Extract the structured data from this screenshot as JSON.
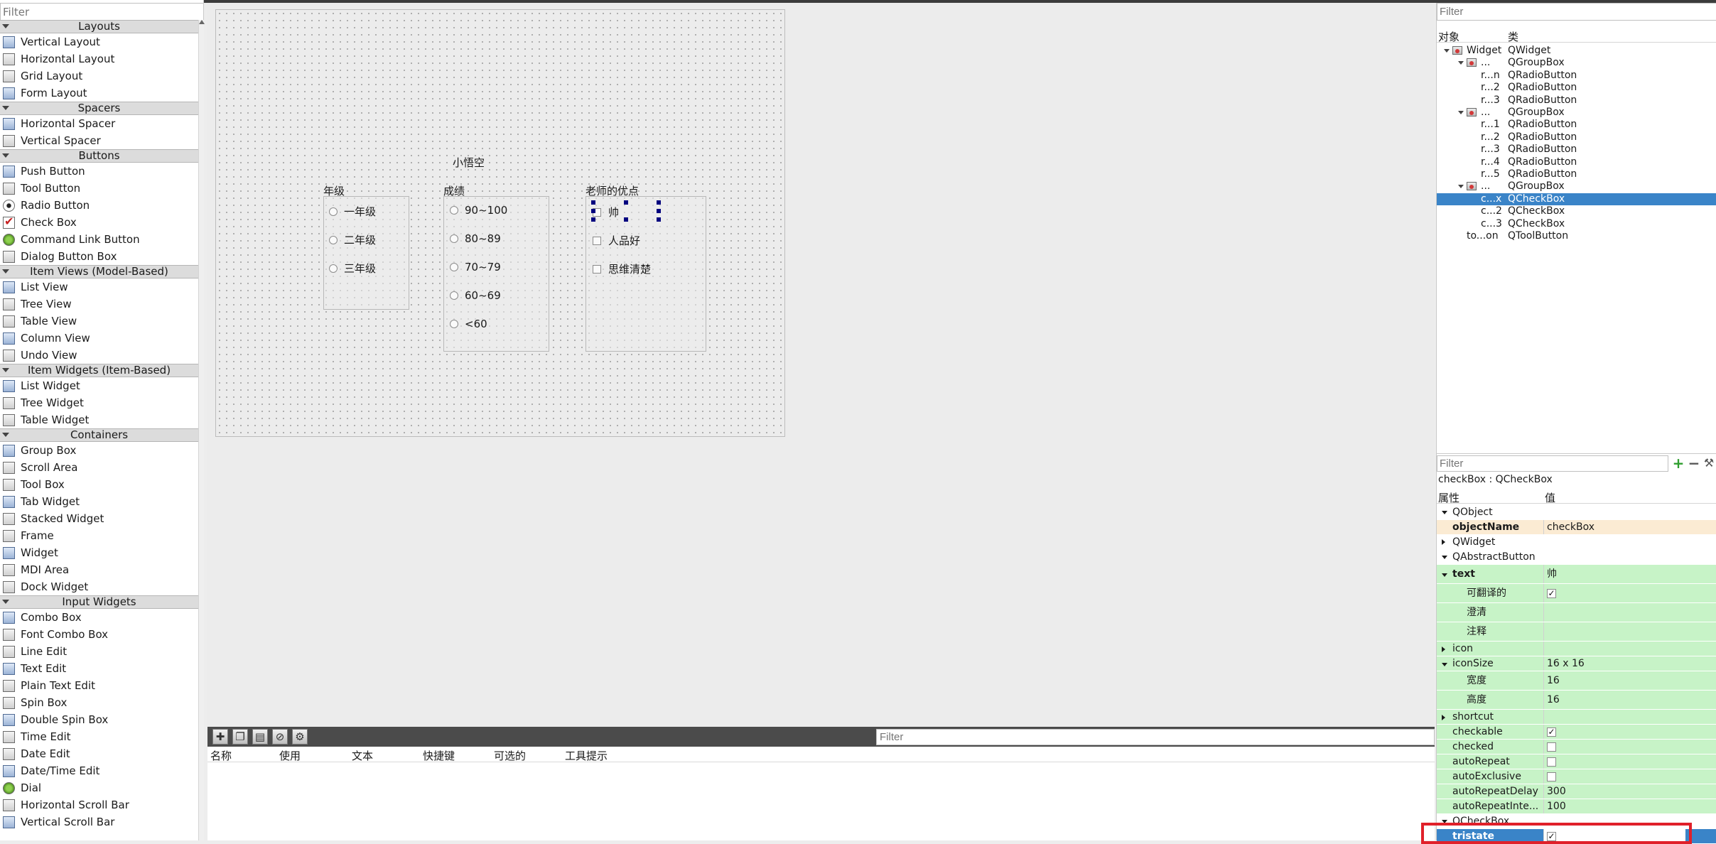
{
  "widget_box": {
    "filter_placeholder": "Filter",
    "categories": [
      {
        "title": "Layouts",
        "items": [
          "Vertical Layout",
          "Horizontal Layout",
          "Grid Layout",
          "Form Layout"
        ]
      },
      {
        "title": "Spacers",
        "items": [
          "Horizontal Spacer",
          "Vertical Spacer"
        ]
      },
      {
        "title": "Buttons",
        "items": [
          "Push Button",
          "Tool Button",
          "Radio Button",
          "Check Box",
          "Command Link Button",
          "Dialog Button Box"
        ]
      },
      {
        "title": "Item Views (Model-Based)",
        "items": [
          "List View",
          "Tree View",
          "Table View",
          "Column View",
          "Undo View"
        ]
      },
      {
        "title": "Item Widgets (Item-Based)",
        "items": [
          "List Widget",
          "Tree Widget",
          "Table Widget"
        ]
      },
      {
        "title": "Containers",
        "items": [
          "Group Box",
          "Scroll Area",
          "Tool Box",
          "Tab Widget",
          "Stacked Widget",
          "Frame",
          "Widget",
          "MDI Area",
          "Dock Widget"
        ]
      },
      {
        "title": "Input Widgets",
        "items": [
          "Combo Box",
          "Font Combo Box",
          "Line Edit",
          "Text Edit",
          "Plain Text Edit",
          "Spin Box",
          "Double Spin Box",
          "Time Edit",
          "Date Edit",
          "Date/Time Edit",
          "Dial",
          "Horizontal Scroll Bar",
          "Vertical Scroll Bar"
        ]
      }
    ]
  },
  "form": {
    "title_label": "小悟空",
    "group_grade": {
      "title": "年级",
      "options": [
        "一年级",
        "二年级",
        "三年级"
      ]
    },
    "group_score": {
      "title": "成绩",
      "options": [
        "90~100",
        "80~89",
        "70~79",
        "60~69",
        "<60"
      ]
    },
    "group_teacher": {
      "title": "老师的优点",
      "options": [
        "帅",
        "人品好",
        "思维清楚"
      ]
    }
  },
  "action_editor": {
    "filter_placeholder": "Filter",
    "columns": [
      "名称",
      "使用",
      "文本",
      "快捷键",
      "可选的",
      "工具提示"
    ]
  },
  "object_inspector": {
    "filter_placeholder": "Filter",
    "columns": [
      "对象",
      "类"
    ],
    "rows": [
      {
        "obj": "Widget",
        "cls": "QWidget",
        "depth": 0,
        "expanded": true,
        "icon": true
      },
      {
        "obj": "...",
        "cls": "QGroupBox",
        "depth": 1,
        "expanded": true,
        "icon": true
      },
      {
        "obj": "r...n",
        "cls": "QRadioButton",
        "depth": 2
      },
      {
        "obj": "r...2",
        "cls": "QRadioButton",
        "depth": 2
      },
      {
        "obj": "r...3",
        "cls": "QRadioButton",
        "depth": 2
      },
      {
        "obj": "...",
        "cls": "QGroupBox",
        "depth": 1,
        "expanded": true,
        "icon": true
      },
      {
        "obj": "r...1",
        "cls": "QRadioButton",
        "depth": 2
      },
      {
        "obj": "r...2",
        "cls": "QRadioButton",
        "depth": 2
      },
      {
        "obj": "r...3",
        "cls": "QRadioButton",
        "depth": 2
      },
      {
        "obj": "r...4",
        "cls": "QRadioButton",
        "depth": 2
      },
      {
        "obj": "r...5",
        "cls": "QRadioButton",
        "depth": 2
      },
      {
        "obj": "...",
        "cls": "QGroupBox",
        "depth": 1,
        "expanded": true,
        "icon": true
      },
      {
        "obj": "c...x",
        "cls": "QCheckBox",
        "depth": 2,
        "selected": true
      },
      {
        "obj": "c...2",
        "cls": "QCheckBox",
        "depth": 2
      },
      {
        "obj": "c...3",
        "cls": "QCheckBox",
        "depth": 2
      },
      {
        "obj": "to...on",
        "cls": "QToolButton",
        "depth": 1
      }
    ]
  },
  "property_editor": {
    "filter_placeholder": "Filter",
    "class_label": "checkBox : QCheckBox",
    "columns": [
      "属性",
      "值"
    ],
    "rows": [
      {
        "kind": "group",
        "name": "QObject",
        "expanded": true
      },
      {
        "kind": "beige",
        "name": "objectName",
        "value": "checkBox",
        "bold": true
      },
      {
        "kind": "group",
        "name": "QWidget",
        "expanded": false
      },
      {
        "kind": "group",
        "name": "QAbstractButton",
        "expanded": true
      },
      {
        "kind": "green",
        "name": "text",
        "value": "帅",
        "bold": true,
        "tri": "down",
        "tall": true
      },
      {
        "kind": "green",
        "name": "可翻译的",
        "checkbox": true,
        "checked": true,
        "sub": true,
        "tall": true
      },
      {
        "kind": "green",
        "name": "澄清",
        "sub": true,
        "tall": true
      },
      {
        "kind": "green",
        "name": "注释",
        "sub": true,
        "tall": true
      },
      {
        "kind": "green",
        "name": "icon",
        "tri": "right"
      },
      {
        "kind": "green",
        "name": "iconSize",
        "value": "16 x 16",
        "tri": "down"
      },
      {
        "kind": "green",
        "name": "宽度",
        "value": "16",
        "sub": true,
        "tall": true
      },
      {
        "kind": "green",
        "name": "高度",
        "value": "16",
        "sub": true,
        "tall": true
      },
      {
        "kind": "green",
        "name": "shortcut",
        "tri": "right"
      },
      {
        "kind": "green",
        "name": "checkable",
        "checkbox": true,
        "checked": true
      },
      {
        "kind": "green",
        "name": "checked",
        "checkbox": true,
        "checked": false
      },
      {
        "kind": "green",
        "name": "autoRepeat",
        "checkbox": true,
        "checked": false
      },
      {
        "kind": "green",
        "name": "autoExclusive",
        "checkbox": true,
        "checked": false
      },
      {
        "kind": "green",
        "name": "autoRepeatDelay",
        "value": "300"
      },
      {
        "kind": "green",
        "name": "autoRepeatInte...",
        "value": "100"
      },
      {
        "kind": "group",
        "name": "QCheckBox",
        "expanded": true
      },
      {
        "kind": "blue",
        "name": "tristate",
        "checkbox": true,
        "checked": true,
        "bold": true
      }
    ]
  },
  "colors": {
    "selection": "#3a84c8",
    "highlight_box": "#e0202a",
    "green_row": "#c7f3c7",
    "group_row": "#a3a3a3"
  }
}
